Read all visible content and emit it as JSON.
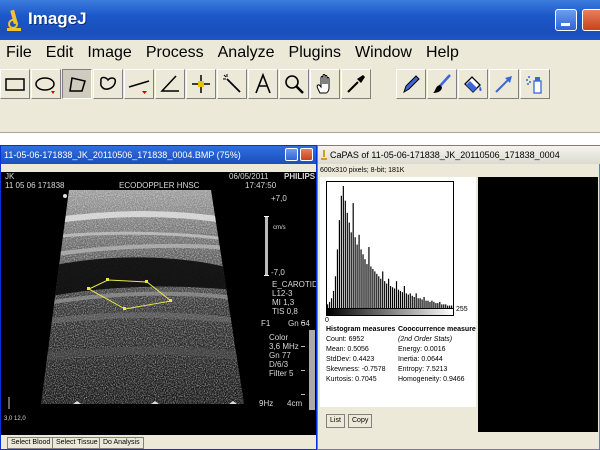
{
  "main_window": {
    "title": "ImageJ",
    "menu": [
      "File",
      "Edit",
      "Image",
      "Process",
      "Analyze",
      "Plugins",
      "Window",
      "Help"
    ],
    "tools": [
      {
        "id": "rectangle",
        "icon": "rectangle-icon"
      },
      {
        "id": "oval",
        "icon": "oval-icon"
      },
      {
        "id": "polygon",
        "icon": "polygon-icon",
        "selected": true
      },
      {
        "id": "freehand",
        "icon": "freehand-icon"
      },
      {
        "id": "line",
        "icon": "line-icon"
      },
      {
        "id": "angle",
        "icon": "angle-icon"
      },
      {
        "id": "point",
        "icon": "point-icon"
      },
      {
        "id": "wand",
        "icon": "wand-icon"
      },
      {
        "id": "text",
        "icon": "text-icon",
        "glyph": "A"
      },
      {
        "id": "zoom",
        "icon": "magnifier-icon"
      },
      {
        "id": "scroll",
        "icon": "hand-icon"
      },
      {
        "id": "color-picker",
        "icon": "dropper-icon"
      },
      {
        "id": "pencil",
        "icon": "pencil-icon"
      },
      {
        "id": "brush",
        "icon": "brush-icon"
      },
      {
        "id": "flood-fill",
        "icon": "fill-icon"
      },
      {
        "id": "arrow",
        "icon": "arrow-icon"
      },
      {
        "id": "spray",
        "icon": "spray-icon"
      }
    ]
  },
  "image_window": {
    "title": "11-05-06-171838_JK_20110506_171838_0004.BMP (75%)",
    "overlay": {
      "patient": "JK",
      "id_line": "11 05 06 171838",
      "hospital": "ECODOPPLER HNSC",
      "date": "06/05/2011",
      "time": "17:47:50",
      "brand": "PHILIPS",
      "scale_top": "+7,0",
      "scale_unit": "cm/s",
      "scale_bottom": "-7,0",
      "probe": "L12-3",
      "preset": "E_CAROTID",
      "mi": "MI 1,3",
      "tis": "TIS 0,8",
      "f1": "F1",
      "gn": "Gn 64",
      "color_label": "Color",
      "freq": "3,6 MHz",
      "gn2": "Gn 77",
      "depth_label": "D/6/3",
      "filter": "Filter 5",
      "hz": "9Hz",
      "depth": "4cm",
      "corner_vals": "3,0 12,0"
    },
    "buttons": [
      "Select Blood",
      "Select Tissue",
      "Do Analysis"
    ]
  },
  "capas_window": {
    "title": "CaPAS of 11-05-06-171838_JK_20110506_171838_0004",
    "info": "600x310 pixels; 8-bit; 181K",
    "hist_min": "0",
    "hist_max": "255",
    "histogram_header": "Histogram measures",
    "cooccurrence_header": "Cooccurrence measures",
    "cooccurrence_sub": "(2nd Order Stats)",
    "histogram_measures": [
      "Count: 6952",
      "Mean: 0.5056",
      "StdDev: 0.4423",
      "Skewness: -0.7578",
      "Kurtosis: 0.7045"
    ],
    "cooccurrence_measures": [
      "Energy: 0.0016",
      "Inertia: 0.0644",
      "Entropy: 7.5213",
      "Homogeneity: 0.9466"
    ],
    "buttons": [
      "List",
      "Copy"
    ]
  },
  "chart_data": {
    "type": "bar",
    "xlim": [
      0,
      255
    ],
    "bins": 64,
    "values": [
      3,
      5,
      8,
      14,
      26,
      48,
      72,
      92,
      100,
      88,
      78,
      70,
      62,
      86,
      58,
      52,
      60,
      48,
      44,
      40,
      36,
      50,
      34,
      32,
      30,
      28,
      26,
      24,
      30,
      22,
      20,
      24,
      18,
      17,
      16,
      22,
      15,
      14,
      13,
      18,
      12,
      11,
      12,
      10,
      9,
      12,
      8,
      8,
      7,
      9,
      6,
      6,
      5,
      6,
      5,
      4,
      4,
      5,
      3,
      3,
      3,
      2,
      2,
      2
    ]
  }
}
